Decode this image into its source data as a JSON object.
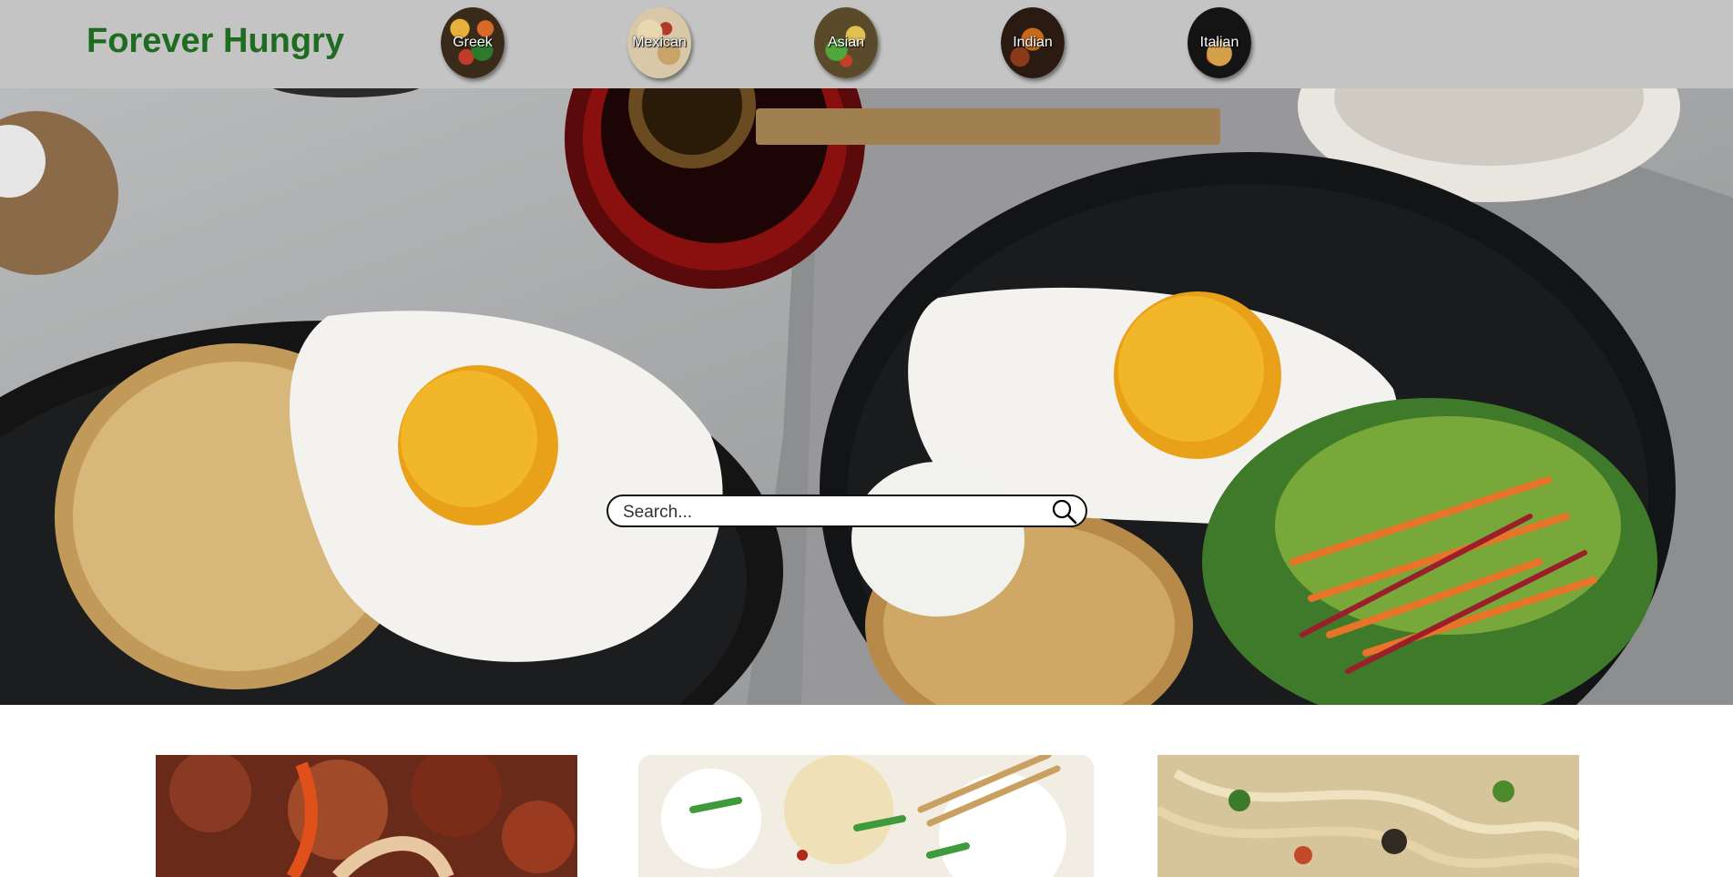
{
  "header": {
    "logo": "Forever Hungry",
    "categories": [
      {
        "label": "Greek"
      },
      {
        "label": "Mexican"
      },
      {
        "label": "Asian"
      },
      {
        "label": "Indian"
      },
      {
        "label": "Italian"
      }
    ]
  },
  "search": {
    "placeholder": "Search...",
    "value": ""
  },
  "colors": {
    "header_bg": "#c4c4c4",
    "logo": "#1f6b1f"
  },
  "icons": {
    "search": "search-icon"
  }
}
